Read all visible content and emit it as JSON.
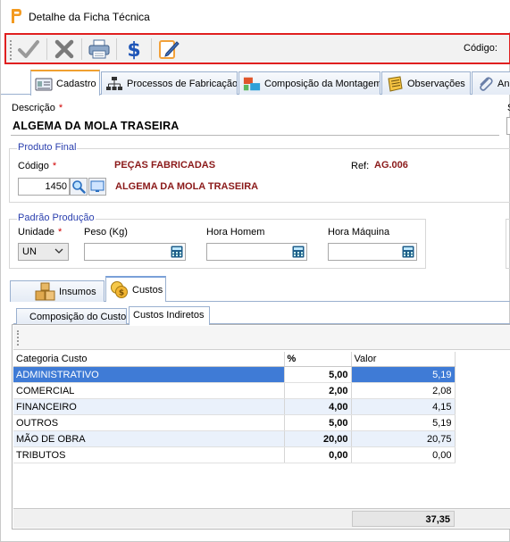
{
  "window": {
    "title": "Detalhe da Ficha Técnica"
  },
  "toolbar": {
    "buttons": [
      {
        "name": "confirm",
        "icon": "checkmark-icon"
      },
      {
        "name": "cancel",
        "icon": "close-icon"
      },
      {
        "name": "print",
        "icon": "printer-icon"
      },
      {
        "name": "prices",
        "icon": "dollar-icon"
      },
      {
        "name": "edit",
        "icon": "edit-icon"
      }
    ],
    "code_label": "Código:"
  },
  "main_tabs": [
    "Cadastro",
    "Processos de Fabricação",
    "Composição da Montagem",
    "Observações",
    "An"
  ],
  "form": {
    "descricao_label": "Descrição",
    "descricao_value": "ALGEMA DA MOLA TRASEIRA",
    "s_label": "S",
    "produto_final": {
      "title": "Produto Final",
      "codigo_label": "Código",
      "codigo_value": "1450",
      "group_name": "PEÇAS FABRICADAS",
      "product_name": "ALGEMA DA MOLA TRASEIRA",
      "ref_label": "Ref:",
      "ref_value": "AG.006"
    },
    "padrao_producao": {
      "title": "Padrão Produção",
      "unidade_label": "Unidade",
      "unidade_value": "UN",
      "peso_label": "Peso (Kg)",
      "hora_homem_label": "Hora Homem",
      "hora_maquina_label": "Hora Máquina"
    }
  },
  "sub_tabs": [
    "Insumos",
    "Custos"
  ],
  "cost_tabs": [
    "Composição do Custo",
    "Custos Indiretos"
  ],
  "grid": {
    "columns": [
      "Categoria Custo",
      "%",
      "Valor"
    ],
    "rows": [
      {
        "categoria": "ADMINISTRATIVO",
        "pct": "5,00",
        "valor": "5,19"
      },
      {
        "categoria": "COMERCIAL",
        "pct": "2,00",
        "valor": "2,08"
      },
      {
        "categoria": "FINANCEIRO",
        "pct": "4,00",
        "valor": "4,15"
      },
      {
        "categoria": "OUTROS",
        "pct": "5,00",
        "valor": "5,19"
      },
      {
        "categoria": "MÃO DE OBRA",
        "pct": "20,00",
        "valor": "20,75"
      },
      {
        "categoria": "TRIBUTOS",
        "pct": "0,00",
        "valor": "0,00"
      }
    ],
    "total": "37,35"
  },
  "colors": {
    "required": "#d00000",
    "group_title": "#2a3fae",
    "dark_red_value": "#8b1a1a",
    "selection": "#3f7bd6",
    "toolbar_highlight": "#e02020"
  }
}
